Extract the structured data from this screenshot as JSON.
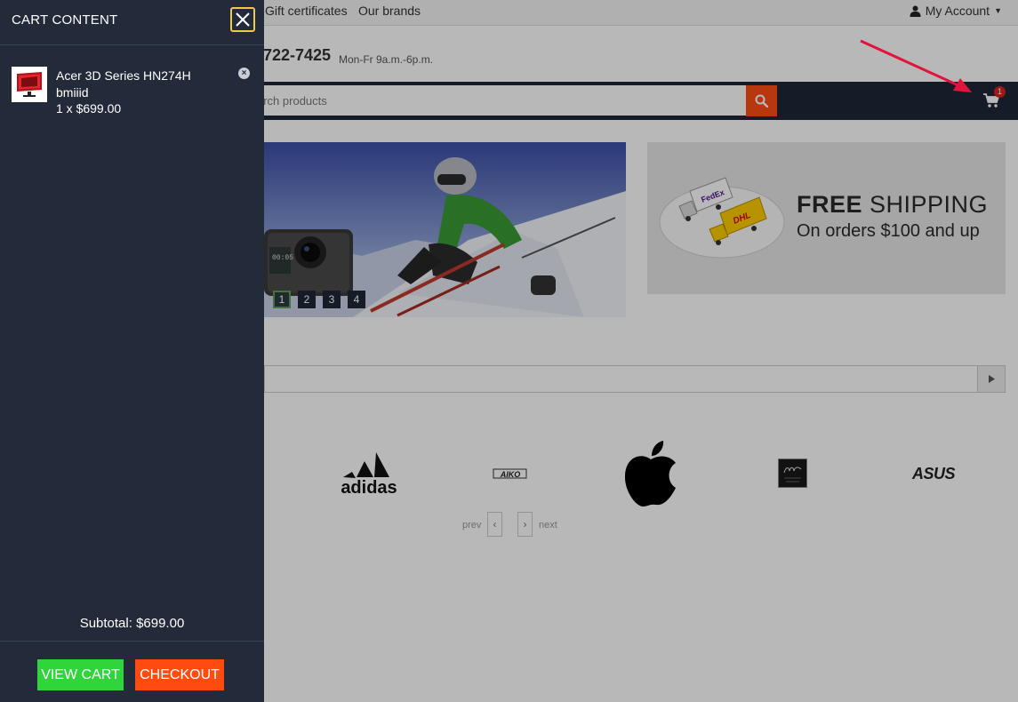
{
  "topbar": {
    "links": [
      "Gift certificates",
      "Our brands"
    ],
    "account_label": "My Account"
  },
  "header": {
    "phone": "722-7425",
    "hours": "Mon-Fr 9a.m.-6p.m."
  },
  "search": {
    "placeholder": "arch products"
  },
  "cart": {
    "badge_count": "1"
  },
  "slider": {
    "pages": [
      "1",
      "2",
      "3",
      "4"
    ],
    "active_page": "1",
    "camera_display": "00:05"
  },
  "banner": {
    "title_bold": "FREE",
    "title_rest": " SHIPPING",
    "subtitle": "On orders $100 and up",
    "truck1_logo": "FedEx",
    "truck2_logo": "DHL"
  },
  "brands": {
    "adidas": "adidas",
    "aiko": "AIKO",
    "asus": "ASUS",
    "prev": "prev",
    "next": "next"
  },
  "drawer": {
    "title": "CART CONTENT",
    "item": {
      "name": "Acer 3D Series HN274H bmiiid",
      "qty_price": "1 x $699.00"
    },
    "subtotal": "Subtotal: $699.00",
    "view_cart": "VIEW CART",
    "checkout": "CHECKOUT"
  },
  "colors": {
    "drawer_bg": "#232b3a",
    "accent_orange": "#ff4a10",
    "accent_green": "#2fd53a",
    "focus_yellow": "#f0c84a",
    "annotation_arrow": "#e0143c"
  }
}
